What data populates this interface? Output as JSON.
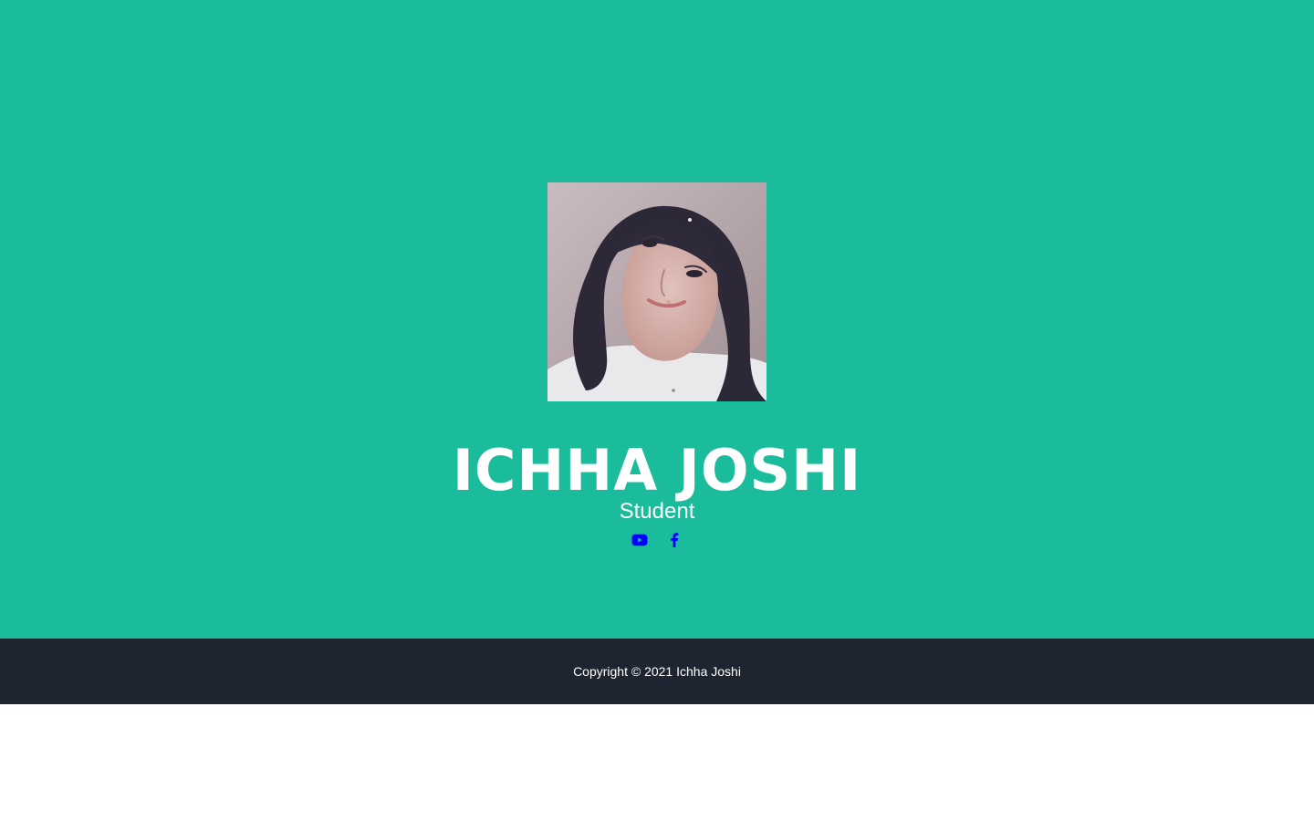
{
  "profile": {
    "name": "ICHHA JOSHI",
    "role": "Student",
    "photo_alt": "profile photo"
  },
  "social": {
    "youtube_label": "YouTube",
    "facebook_label": "Facebook"
  },
  "footer": {
    "copyright": "Copyright © 2021 Ichha Joshi"
  },
  "colors": {
    "hero_background": "#1abc9c",
    "footer_background": "#1e2530",
    "social_icon": "#0000ff",
    "text": "#ffffff"
  },
  "icons": {
    "youtube": "youtube-icon",
    "facebook": "facebook-icon"
  }
}
